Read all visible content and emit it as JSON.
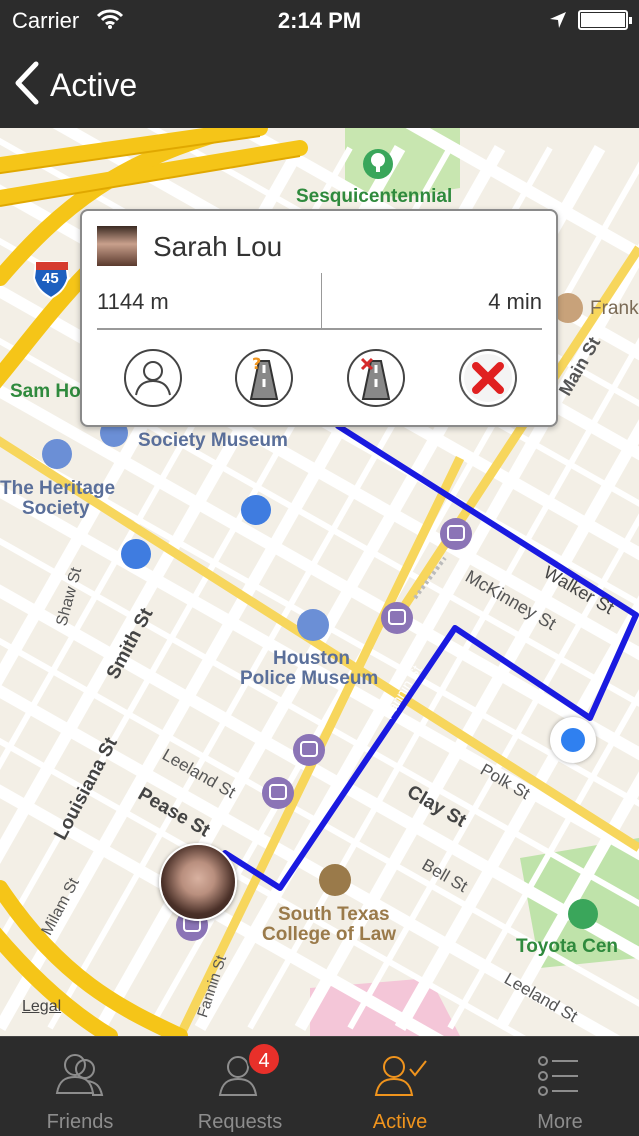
{
  "status_bar": {
    "carrier": "Carrier",
    "time": "2:14 PM"
  },
  "nav": {
    "back_title": "Active"
  },
  "map": {
    "labels": {
      "sesquicentennial": "Sesquicentennial",
      "frank": "Frank",
      "main_st": "Main St",
      "sam_ho": "Sam Ho",
      "society_museum": "Society Museum",
      "heritage_1": "The Heritage",
      "heritage_2": "Society",
      "shaw_st": "Shaw St",
      "smith_st": "Smith St",
      "walker_st": "Walker St",
      "mckinney_st": "McKinney St",
      "houston_1": "Houston",
      "houston_2": "Police Museum",
      "fannin_st": "Fannin St",
      "fannin_st_2": "Fannin St",
      "leeland_st": "Leeland St",
      "leeland_st_2": "Leeland St",
      "louisiana_st": "Louisiana St",
      "pease_st": "Pease St",
      "clay_st": "Clay St",
      "polk_st": "Polk St",
      "bell_st": "Bell St",
      "milam_st": "Milam St",
      "south_texas_1": "South Texas",
      "south_texas_2": "College of Law",
      "toyota": "Toyota Cen",
      "interstate": "45",
      "legal": "Legal"
    }
  },
  "popup": {
    "name": "Sarah Lou",
    "distance": "1144 m",
    "duration": "4 min"
  },
  "tabs": [
    {
      "label": "Friends"
    },
    {
      "label": "Requests",
      "badge": "4"
    },
    {
      "label": "Active"
    },
    {
      "label": "More"
    }
  ],
  "colors": {
    "bar_bg": "#2c2c2c",
    "active_tab": "#f0941d",
    "inactive_tab": "#8d8d8d",
    "route": "#1a1ae0",
    "badge": "#e8302a",
    "freeway": "#f5c518",
    "location_dot": "#2f80f0"
  }
}
